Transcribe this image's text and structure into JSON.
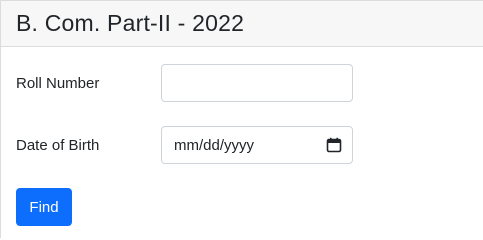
{
  "header": {
    "title": "B. Com. Part-II - 2022"
  },
  "form": {
    "roll_number": {
      "label": "Roll Number",
      "value": ""
    },
    "date_of_birth": {
      "label": "Date of Birth",
      "value": "mm/dd/yyyy",
      "icon": "calendar-icon"
    },
    "submit_label": "Find"
  },
  "colors": {
    "primary": "#0d6efd",
    "header_bg": "#f7f7f7"
  }
}
